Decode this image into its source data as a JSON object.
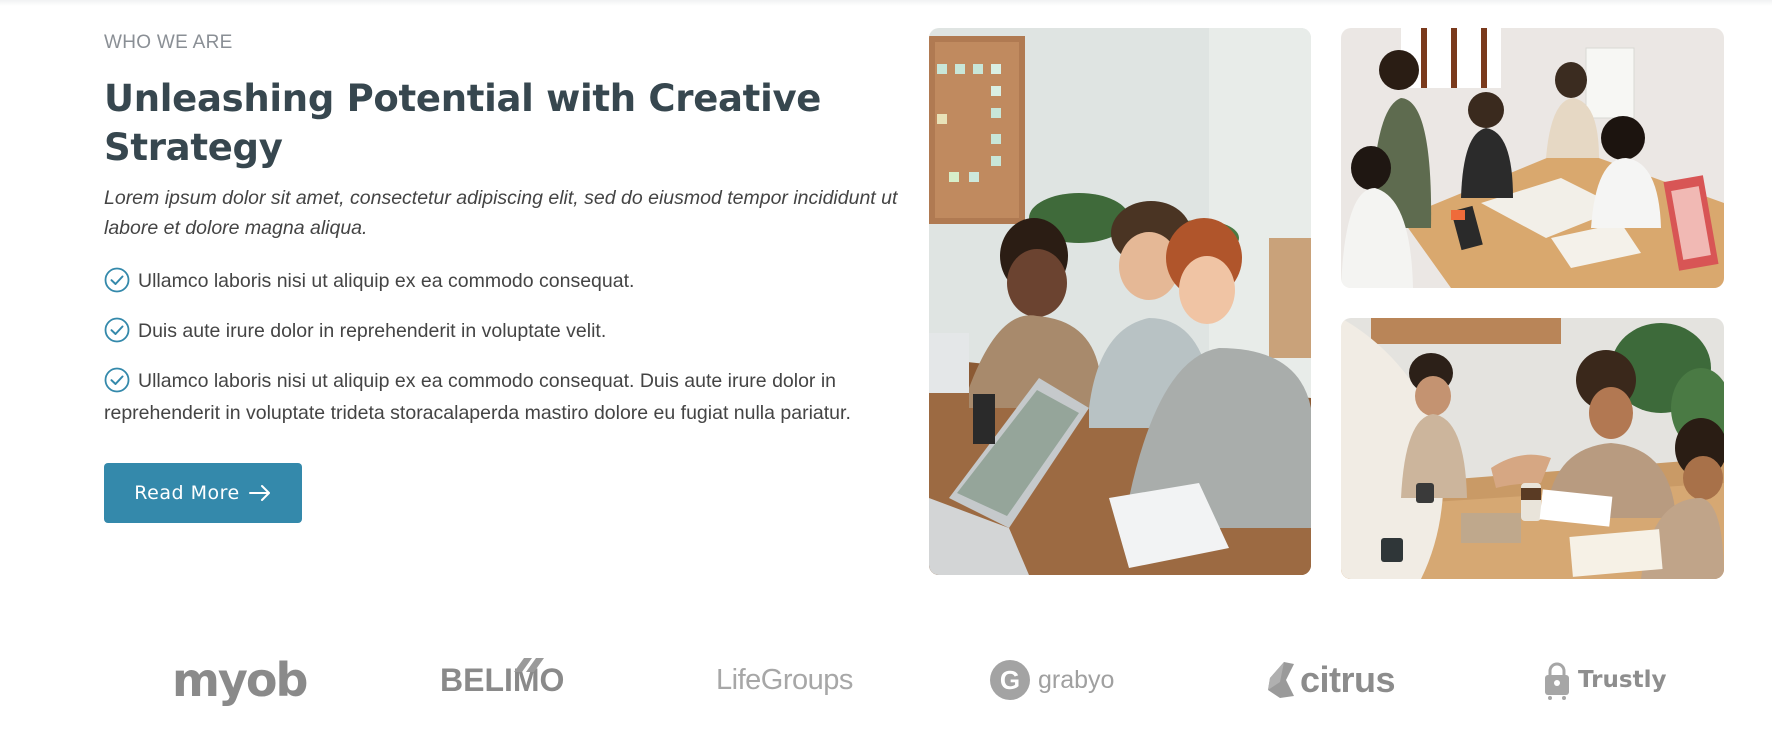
{
  "about": {
    "eyebrow": "WHO WE ARE",
    "title": "Unleashing Potential with Creative Strategy",
    "lead": "Lorem ipsum dolor sit amet, consectetur adipiscing elit, sed do eiusmod tempor incididunt ut labore et dolore magna aliqua.",
    "checklist": [
      "Ullamco laboris nisi ut aliquip ex ea commodo consequat.",
      "Duis aute irure dolor in reprehenderit in voluptate velit.",
      "Ullamco laboris nisi ut aliquip ex ea commodo consequat. Duis aute irure dolor in reprehenderit in voluptate trideta storacalaperda mastiro dolore eu fugiat nulla pariatur."
    ],
    "cta_label": "Read More",
    "check_icon": "check-circle-icon",
    "cta_icon": "arrow-right-icon"
  },
  "photos": [
    {
      "name": "team-meeting-photo"
    },
    {
      "name": "team-collaboration-photo"
    },
    {
      "name": "handshake-photo"
    }
  ],
  "clients": {
    "logos": [
      "myob",
      "BELIMO",
      "LifeGroups",
      "grabyo",
      "citrus",
      "Trustly"
    ]
  },
  "colors": {
    "accent": "#3489ab",
    "heading": "#37474f",
    "body_text": "#444444",
    "eyebrow": "#8a8f95",
    "logo_gray": "#8e8e8e"
  }
}
